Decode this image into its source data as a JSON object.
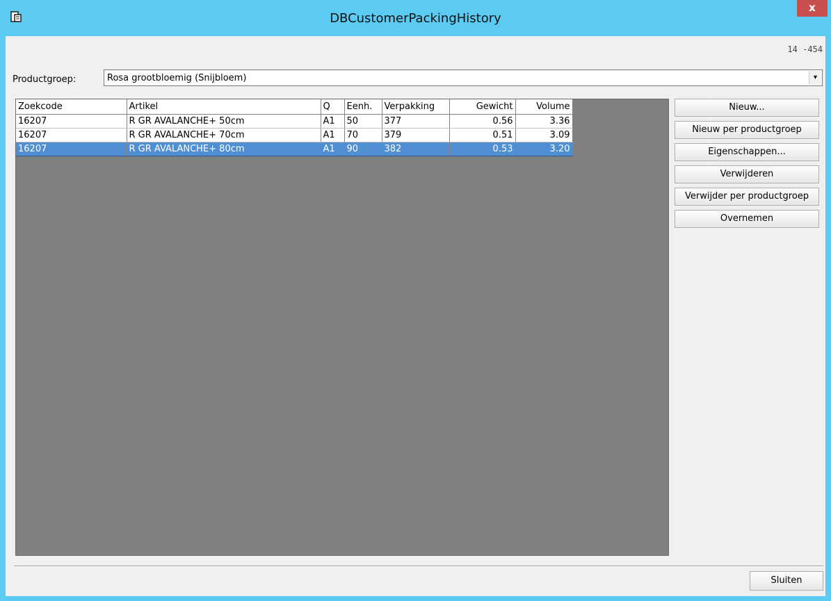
{
  "window": {
    "title": "DBCustomerPackingHistory",
    "close_glyph": "x",
    "app_icon": "document-window-icon",
    "code": "14 -454"
  },
  "filter": {
    "label": "Productgroep:",
    "value": "Rosa grootbloemig (Snijbloem)",
    "arrow": "▾"
  },
  "table": {
    "columns": [
      "Zoekcode",
      "Artikel",
      "Q",
      "Eenh.",
      "Verpakking",
      "Gewicht",
      "Volume"
    ],
    "rows": [
      {
        "zoekcode": "16207",
        "artikel": "R GR AVALANCHE+ 50cm",
        "q": "A1",
        "eenh": "50",
        "verpakking": "377",
        "gewicht": "0.56",
        "volume": "3.36"
      },
      {
        "zoekcode": "16207",
        "artikel": "R GR AVALANCHE+ 70cm",
        "q": "A1",
        "eenh": "70",
        "verpakking": "379",
        "gewicht": "0.51",
        "volume": "3.09"
      },
      {
        "zoekcode": "16207",
        "artikel": "R GR AVALANCHE+ 80cm",
        "q": "A1",
        "eenh": "90",
        "verpakking": "382",
        "gewicht": "0.53",
        "volume": "3.20"
      }
    ],
    "selected_row": 3
  },
  "buttons": {
    "new": "Nieuw...",
    "new_per_group": "Nieuw per productgroep",
    "properties": "Eigenschappen...",
    "delete": "Verwijderen",
    "delete_per_group": "Verwijder per productgroep",
    "take_over": "Overnemen",
    "close": "Sluiten"
  },
  "colors": {
    "title_bar": "#5ccbf3",
    "close_button": "#c7504e",
    "selection": "#4f8fd2",
    "grid_background": "#808080"
  }
}
